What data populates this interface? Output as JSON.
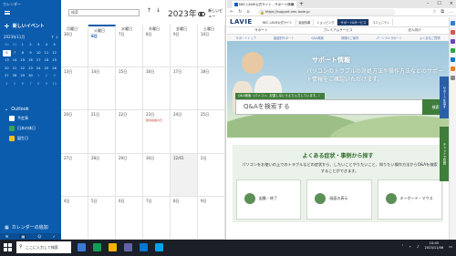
{
  "calendar": {
    "app_title": "カレンダー",
    "new_event": "新しいイベント",
    "mini_month": "2023年11月",
    "mini_days": [
      "30",
      "31",
      "1",
      "2",
      "3",
      "4",
      "5",
      "6",
      "7",
      "8",
      "9",
      "10",
      "11",
      "12",
      "13",
      "14",
      "15",
      "16",
      "17",
      "18",
      "19",
      "20",
      "21",
      "22",
      "23",
      "24",
      "25",
      "26",
      "27",
      "28",
      "29",
      "30",
      "1",
      "2",
      "3",
      "4",
      "5",
      "6",
      "7",
      "8",
      "9",
      "10"
    ],
    "outlook_label": "Outlook",
    "calendars": [
      {
        "label": "予定表",
        "color": "#ffffff"
      },
      {
        "label": "日本の休日",
        "color": "#3aa35a"
      },
      {
        "label": "誕生日",
        "color": "#f0c419"
      }
    ],
    "add_calendar": "カレンダーの追加",
    "search_placeholder": "検索",
    "month_title": "2023年11月",
    "day_mode": "新しいビュー",
    "grid": [
      [
        "30日",
        "6日",
        "7日",
        "8日",
        "9日",
        "10日"
      ],
      [
        "13日",
        "14日",
        "15日",
        "16日",
        "17日",
        "18日"
      ],
      [
        "20日",
        "21日",
        "22日",
        "23日",
        "24日",
        "25日"
      ],
      [
        "27日",
        "28日",
        "29日",
        "30日",
        "12/01",
        "2日"
      ],
      [
        "4日",
        "5日",
        "6日",
        "7日",
        "8日",
        "9日"
      ]
    ],
    "weekday_labels": [
      "月曜日",
      "火曜日",
      "水曜日",
      "木曜日",
      "金曜日",
      "土曜日"
    ],
    "holiday_event": "勤労感謝の日"
  },
  "browser": {
    "tab_title": "NEC LAVIE公式サイト - サポート情報",
    "url": "https://support.nec-lavie.jp",
    "logo": "LAVIE",
    "top_nav": [
      "NEC LAVIE公式サイト",
      "製品情報",
      "ショッピング",
      "サポート&サービス",
      "コミュニティ"
    ],
    "sub_nav": [
      "サポート",
      "プレミアムサービス",
      "法人向け"
    ],
    "sub_nav2": [
      "サポートトップ",
      "製品別サポート",
      "Q&A検索",
      "修理のご案内",
      "パーソナルサポート",
      "よくあるご質問"
    ],
    "hero_title": "サポート情報",
    "hero_desc": "パソコンのトラブルの対処方法や操作方法などのサポート情報をご確認いただけます。",
    "qa_label": "Q&A検索（パソコン、記載しないうえで入力しています。）",
    "qa_placeholder": "Q&Aを検索する",
    "qa_button": "検索",
    "faq_title": "よくある症状・事例から探す",
    "faq_desc": "パソコンをお使いの上でのトラブルなどの症状から、したいことやりたいこと、知りたい操作方法からQ&Aを検索することができます。",
    "cards": [
      "起動・終了",
      "画面の表示",
      "キーボード・マウス"
    ],
    "side_tab": "チャットで質問",
    "side_tab2": "サポートを探す"
  },
  "taskbar": {
    "search_placeholder": "ここに入力して検索",
    "time": "10:45",
    "date": "2023/11/06"
  }
}
